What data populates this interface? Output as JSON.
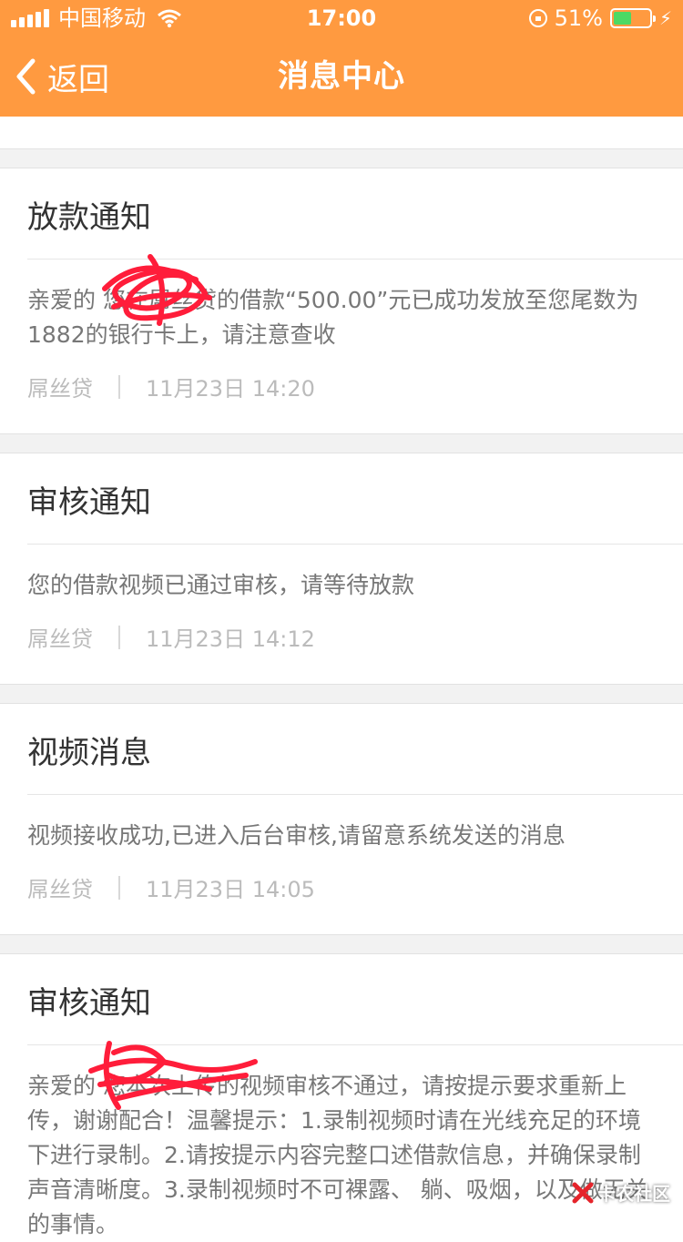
{
  "status_bar": {
    "carrier": "中国移动",
    "time": "17:00",
    "battery_percent": "51%",
    "battery_level": 0.51,
    "battery_color": "#4cd964"
  },
  "nav": {
    "back_label": "返回",
    "title": "消息中心",
    "bg_color": "#ff9a40"
  },
  "messages": [
    {
      "title": "放款通知",
      "body": "亲爱的 您在屌丝贷的借款“500.00”元已成功发放至您尾数为1882的银行卡上，请注意查收",
      "source": "屌丝贷",
      "time": "11月23日 14:20"
    },
    {
      "title": "审核通知",
      "body": "您的借款视频已通过审核，请等待放款",
      "source": "屌丝贷",
      "time": "11月23日 14:12"
    },
    {
      "title": "视频消息",
      "body": "视频接收成功,已进入后台审核,请留意系统发送的消息",
      "source": "屌丝贷",
      "time": "11月23日 14:05"
    },
    {
      "title": "审核通知",
      "body": "亲爱的 您本次上传的视频审核不通过，请按提示要求重新上传，谢谢配合！温馨提示：1.录制视频时请在光线充足的环境下进行录制。2.请按提示内容完整口述借款信息，并确保录制声音清晰度。3.录制视频时不可裸露、 躺、吸烟，以及做无关的事情。",
      "source": "",
      "time": ""
    }
  ],
  "watermark": "卡农社区"
}
